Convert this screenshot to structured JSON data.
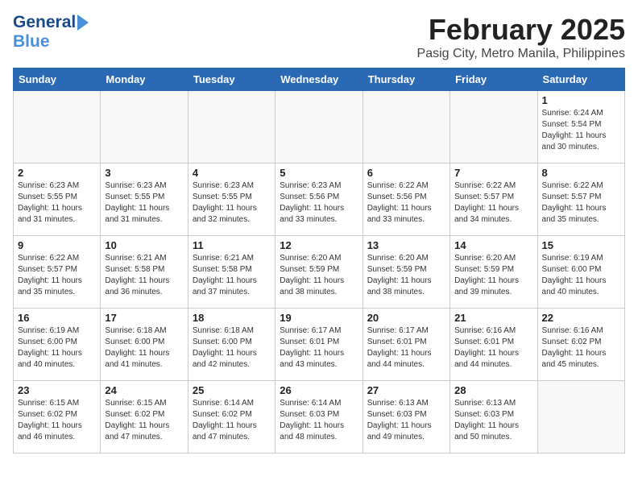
{
  "header": {
    "logo_general": "General",
    "logo_blue": "Blue",
    "main_title": "February 2025",
    "subtitle": "Pasig City, Metro Manila, Philippines"
  },
  "calendar": {
    "days_of_week": [
      "Sunday",
      "Monday",
      "Tuesday",
      "Wednesday",
      "Thursday",
      "Friday",
      "Saturday"
    ],
    "weeks": [
      [
        {
          "day": "",
          "info": ""
        },
        {
          "day": "",
          "info": ""
        },
        {
          "day": "",
          "info": ""
        },
        {
          "day": "",
          "info": ""
        },
        {
          "day": "",
          "info": ""
        },
        {
          "day": "",
          "info": ""
        },
        {
          "day": "1",
          "info": "Sunrise: 6:24 AM\nSunset: 5:54 PM\nDaylight: 11 hours\nand 30 minutes."
        }
      ],
      [
        {
          "day": "2",
          "info": "Sunrise: 6:23 AM\nSunset: 5:55 PM\nDaylight: 11 hours\nand 31 minutes."
        },
        {
          "day": "3",
          "info": "Sunrise: 6:23 AM\nSunset: 5:55 PM\nDaylight: 11 hours\nand 31 minutes."
        },
        {
          "day": "4",
          "info": "Sunrise: 6:23 AM\nSunset: 5:55 PM\nDaylight: 11 hours\nand 32 minutes."
        },
        {
          "day": "5",
          "info": "Sunrise: 6:23 AM\nSunset: 5:56 PM\nDaylight: 11 hours\nand 33 minutes."
        },
        {
          "day": "6",
          "info": "Sunrise: 6:22 AM\nSunset: 5:56 PM\nDaylight: 11 hours\nand 33 minutes."
        },
        {
          "day": "7",
          "info": "Sunrise: 6:22 AM\nSunset: 5:57 PM\nDaylight: 11 hours\nand 34 minutes."
        },
        {
          "day": "8",
          "info": "Sunrise: 6:22 AM\nSunset: 5:57 PM\nDaylight: 11 hours\nand 35 minutes."
        }
      ],
      [
        {
          "day": "9",
          "info": "Sunrise: 6:22 AM\nSunset: 5:57 PM\nDaylight: 11 hours\nand 35 minutes."
        },
        {
          "day": "10",
          "info": "Sunrise: 6:21 AM\nSunset: 5:58 PM\nDaylight: 11 hours\nand 36 minutes."
        },
        {
          "day": "11",
          "info": "Sunrise: 6:21 AM\nSunset: 5:58 PM\nDaylight: 11 hours\nand 37 minutes."
        },
        {
          "day": "12",
          "info": "Sunrise: 6:20 AM\nSunset: 5:59 PM\nDaylight: 11 hours\nand 38 minutes."
        },
        {
          "day": "13",
          "info": "Sunrise: 6:20 AM\nSunset: 5:59 PM\nDaylight: 11 hours\nand 38 minutes."
        },
        {
          "day": "14",
          "info": "Sunrise: 6:20 AM\nSunset: 5:59 PM\nDaylight: 11 hours\nand 39 minutes."
        },
        {
          "day": "15",
          "info": "Sunrise: 6:19 AM\nSunset: 6:00 PM\nDaylight: 11 hours\nand 40 minutes."
        }
      ],
      [
        {
          "day": "16",
          "info": "Sunrise: 6:19 AM\nSunset: 6:00 PM\nDaylight: 11 hours\nand 40 minutes."
        },
        {
          "day": "17",
          "info": "Sunrise: 6:18 AM\nSunset: 6:00 PM\nDaylight: 11 hours\nand 41 minutes."
        },
        {
          "day": "18",
          "info": "Sunrise: 6:18 AM\nSunset: 6:00 PM\nDaylight: 11 hours\nand 42 minutes."
        },
        {
          "day": "19",
          "info": "Sunrise: 6:17 AM\nSunset: 6:01 PM\nDaylight: 11 hours\nand 43 minutes."
        },
        {
          "day": "20",
          "info": "Sunrise: 6:17 AM\nSunset: 6:01 PM\nDaylight: 11 hours\nand 44 minutes."
        },
        {
          "day": "21",
          "info": "Sunrise: 6:16 AM\nSunset: 6:01 PM\nDaylight: 11 hours\nand 44 minutes."
        },
        {
          "day": "22",
          "info": "Sunrise: 6:16 AM\nSunset: 6:02 PM\nDaylight: 11 hours\nand 45 minutes."
        }
      ],
      [
        {
          "day": "23",
          "info": "Sunrise: 6:15 AM\nSunset: 6:02 PM\nDaylight: 11 hours\nand 46 minutes."
        },
        {
          "day": "24",
          "info": "Sunrise: 6:15 AM\nSunset: 6:02 PM\nDaylight: 11 hours\nand 47 minutes."
        },
        {
          "day": "25",
          "info": "Sunrise: 6:14 AM\nSunset: 6:02 PM\nDaylight: 11 hours\nand 47 minutes."
        },
        {
          "day": "26",
          "info": "Sunrise: 6:14 AM\nSunset: 6:03 PM\nDaylight: 11 hours\nand 48 minutes."
        },
        {
          "day": "27",
          "info": "Sunrise: 6:13 AM\nSunset: 6:03 PM\nDaylight: 11 hours\nand 49 minutes."
        },
        {
          "day": "28",
          "info": "Sunrise: 6:13 AM\nSunset: 6:03 PM\nDaylight: 11 hours\nand 50 minutes."
        },
        {
          "day": "",
          "info": ""
        }
      ]
    ]
  }
}
